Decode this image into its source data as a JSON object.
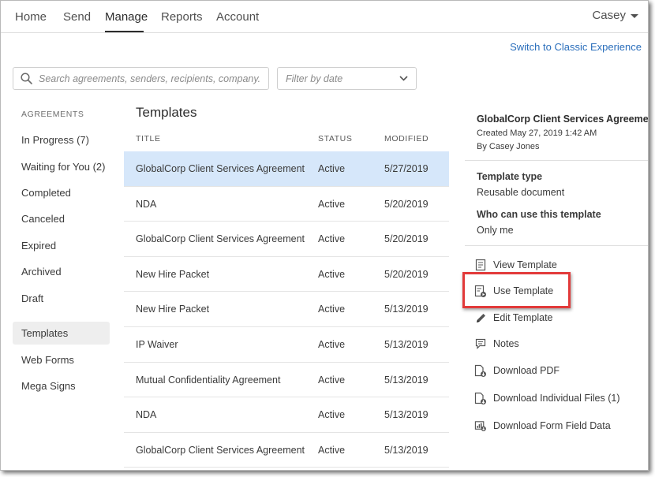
{
  "nav": {
    "items": [
      {
        "label": "Home",
        "active": false
      },
      {
        "label": "Send",
        "active": false
      },
      {
        "label": "Manage",
        "active": true
      },
      {
        "label": "Reports",
        "active": false
      },
      {
        "label": "Account",
        "active": false
      }
    ],
    "user": "Casey"
  },
  "switch_link": "Switch to Classic Experience",
  "search": {
    "placeholder": "Search agreements, senders, recipients, company..."
  },
  "filter": {
    "placeholder": "Filter by date"
  },
  "sidebar": {
    "heading": "AGREEMENTS",
    "items": [
      {
        "label": "In Progress (7)",
        "active": false
      },
      {
        "label": "Waiting for You (2)",
        "active": false
      },
      {
        "label": "Completed",
        "active": false
      },
      {
        "label": "Canceled",
        "active": false
      },
      {
        "label": "Expired",
        "active": false
      },
      {
        "label": "Archived",
        "active": false
      },
      {
        "label": "Draft",
        "active": false
      },
      {
        "label": "Templates",
        "active": true
      },
      {
        "label": "Web Forms",
        "active": false
      },
      {
        "label": "Mega Signs",
        "active": false
      }
    ]
  },
  "templates": {
    "title": "Templates",
    "columns": {
      "title": "TITLE",
      "status": "STATUS",
      "modified": "MODIFIED"
    },
    "rows": [
      {
        "title": "GlobalCorp Client Services Agreement",
        "status": "Active",
        "modified": "5/27/2019",
        "selected": true
      },
      {
        "title": "NDA",
        "status": "Active",
        "modified": "5/20/2019",
        "selected": false
      },
      {
        "title": "GlobalCorp Client Services Agreement",
        "status": "Active",
        "modified": "5/20/2019",
        "selected": false
      },
      {
        "title": "New Hire Packet",
        "status": "Active",
        "modified": "5/20/2019",
        "selected": false
      },
      {
        "title": "New Hire Packet",
        "status": "Active",
        "modified": "5/13/2019",
        "selected": false
      },
      {
        "title": "IP Waiver",
        "status": "Active",
        "modified": "5/13/2019",
        "selected": false
      },
      {
        "title": "Mutual Confidentiality Agreement",
        "status": "Active",
        "modified": "5/13/2019",
        "selected": false
      },
      {
        "title": "NDA",
        "status": "Active",
        "modified": "5/13/2019",
        "selected": false
      },
      {
        "title": "GlobalCorp Client Services Agreement",
        "status": "Active",
        "modified": "5/13/2019",
        "selected": false
      }
    ]
  },
  "details": {
    "title": "GlobalCorp Client Services Agreement",
    "created": "Created May 27, 2019 1:42 AM",
    "by": "By Casey Jones",
    "type_label": "Template type",
    "type_value": "Reusable document",
    "who_label": "Who can use this template",
    "who_value": "Only me",
    "actions": [
      {
        "label": "View Template",
        "icon": "view-template-icon"
      },
      {
        "label": "Use Template",
        "icon": "use-template-icon"
      },
      {
        "label": "Edit Template",
        "icon": "pencil-icon"
      },
      {
        "label": "Notes",
        "icon": "notes-icon"
      },
      {
        "label": "Download PDF",
        "icon": "download-pdf-icon"
      },
      {
        "label": "Download Individual Files (1)",
        "icon": "download-files-icon"
      },
      {
        "label": "Download Form Field Data",
        "icon": "form-data-icon"
      }
    ]
  },
  "colors": {
    "link": "#2a6ebb",
    "selected_row": "#d6e7fa",
    "highlight": "#e23a3a",
    "active_sidebar": "#eeeeee"
  }
}
